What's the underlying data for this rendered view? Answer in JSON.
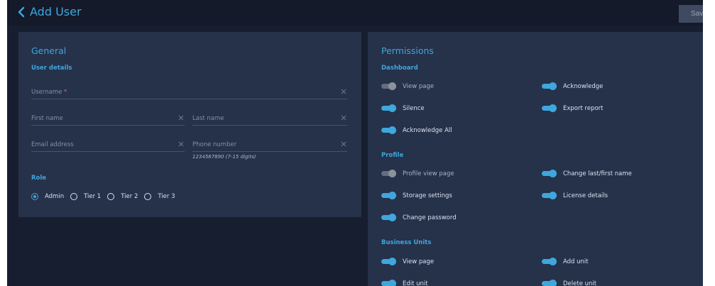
{
  "header": {
    "title": "Add User",
    "save_label": "Sav"
  },
  "general": {
    "title": "General",
    "user_details_label": "User details",
    "fields": {
      "username": {
        "placeholder": "Username",
        "required_mark": "*"
      },
      "first_name": {
        "placeholder": "First name"
      },
      "last_name": {
        "placeholder": "Last name"
      },
      "email": {
        "placeholder": "Email address"
      },
      "phone": {
        "placeholder": "Phone number",
        "hint": "1234567890 (7-15 digits)"
      }
    },
    "role_label": "Role",
    "roles": [
      {
        "label": "Admin",
        "selected": true
      },
      {
        "label": "Tier 1",
        "selected": false
      },
      {
        "label": "Tier 2",
        "selected": false
      },
      {
        "label": "Tier 3",
        "selected": false
      }
    ]
  },
  "permissions": {
    "title": "Permissions",
    "sections": {
      "dashboard": {
        "label": "Dashboard",
        "items": [
          {
            "label": "View page",
            "enabled": false
          },
          {
            "label": "Acknowledge",
            "enabled": true
          },
          {
            "label": "Silence",
            "enabled": true
          },
          {
            "label": "Export report",
            "enabled": true
          },
          {
            "label": "Acknowledge All",
            "enabled": true
          }
        ]
      },
      "profile": {
        "label": "Profile",
        "items": [
          {
            "label": "Profile view page",
            "enabled": false
          },
          {
            "label": "Change last/first name",
            "enabled": true
          },
          {
            "label": "Storage settings",
            "enabled": true
          },
          {
            "label": "License details",
            "enabled": true
          },
          {
            "label": "Change password",
            "enabled": true
          }
        ]
      },
      "business_units": {
        "label": "Business Units",
        "items": [
          {
            "label": "View page",
            "enabled": true
          },
          {
            "label": "Add unit",
            "enabled": true
          },
          {
            "label": "Edit unit",
            "enabled": true
          },
          {
            "label": "Delete unit",
            "enabled": true
          }
        ]
      }
    }
  },
  "colors": {
    "accent": "#3ea7dd",
    "background": "#171e30",
    "card": "#26314a",
    "required": "#e26a72"
  }
}
